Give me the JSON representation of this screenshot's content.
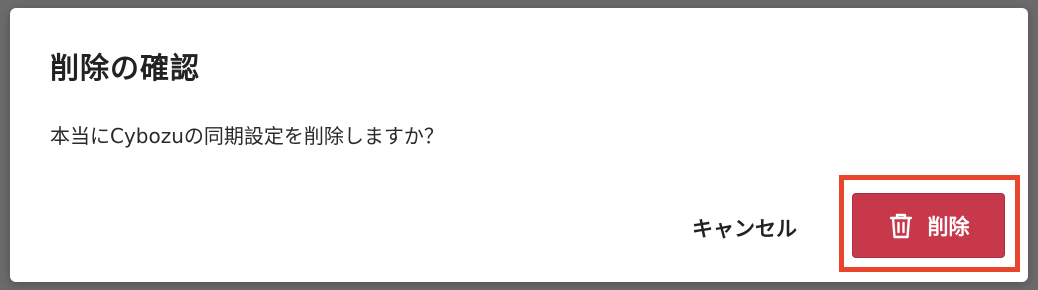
{
  "background": {
    "fragment_1": "",
    "fragment_2": ""
  },
  "dialog": {
    "title": "削除の確認",
    "message": "本当にCybozuの同期設定を削除しますか？",
    "cancel_label": "キャンセル",
    "delete_label": "削除",
    "delete_icon": "trash-icon"
  },
  "colors": {
    "delete_button": "#c7384b",
    "highlight": "#e8452c",
    "overlay": "#6b6b6b"
  }
}
